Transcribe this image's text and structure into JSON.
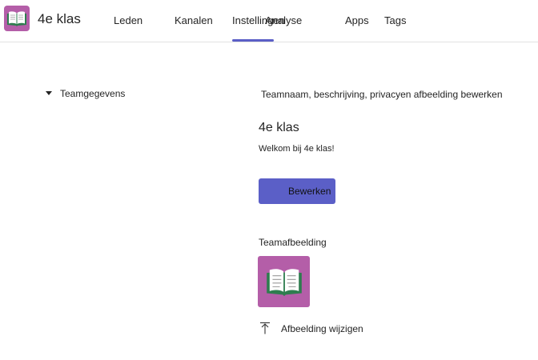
{
  "header": {
    "team_name": "4e klas",
    "tabs": [
      {
        "label": "Leden"
      },
      {
        "label": "Kanalen"
      },
      {
        "label": "Instellingen"
      },
      {
        "label": "Analyse"
      },
      {
        "label": "Apps"
      },
      {
        "label": "Tags"
      }
    ],
    "active_tab": "Instellingen",
    "team_icon": "open-book-icon"
  },
  "section": {
    "label": "Teamgegevens"
  },
  "details": {
    "edit_caption": "Teamnaam, beschrijving, privacyen afbeelding bewerken",
    "team_display_name": "4e klas",
    "description": "Welkom bij 4e klas!",
    "edit_button": "Bewerken",
    "picture_heading": "Teamafbeelding",
    "change_picture": "Afbeelding wijzigen",
    "upload_icon": "upload-icon"
  },
  "colors": {
    "accent": "#5b5fc7",
    "team_tile": "#b45ea8",
    "book_cover": "#2e7d4f"
  }
}
